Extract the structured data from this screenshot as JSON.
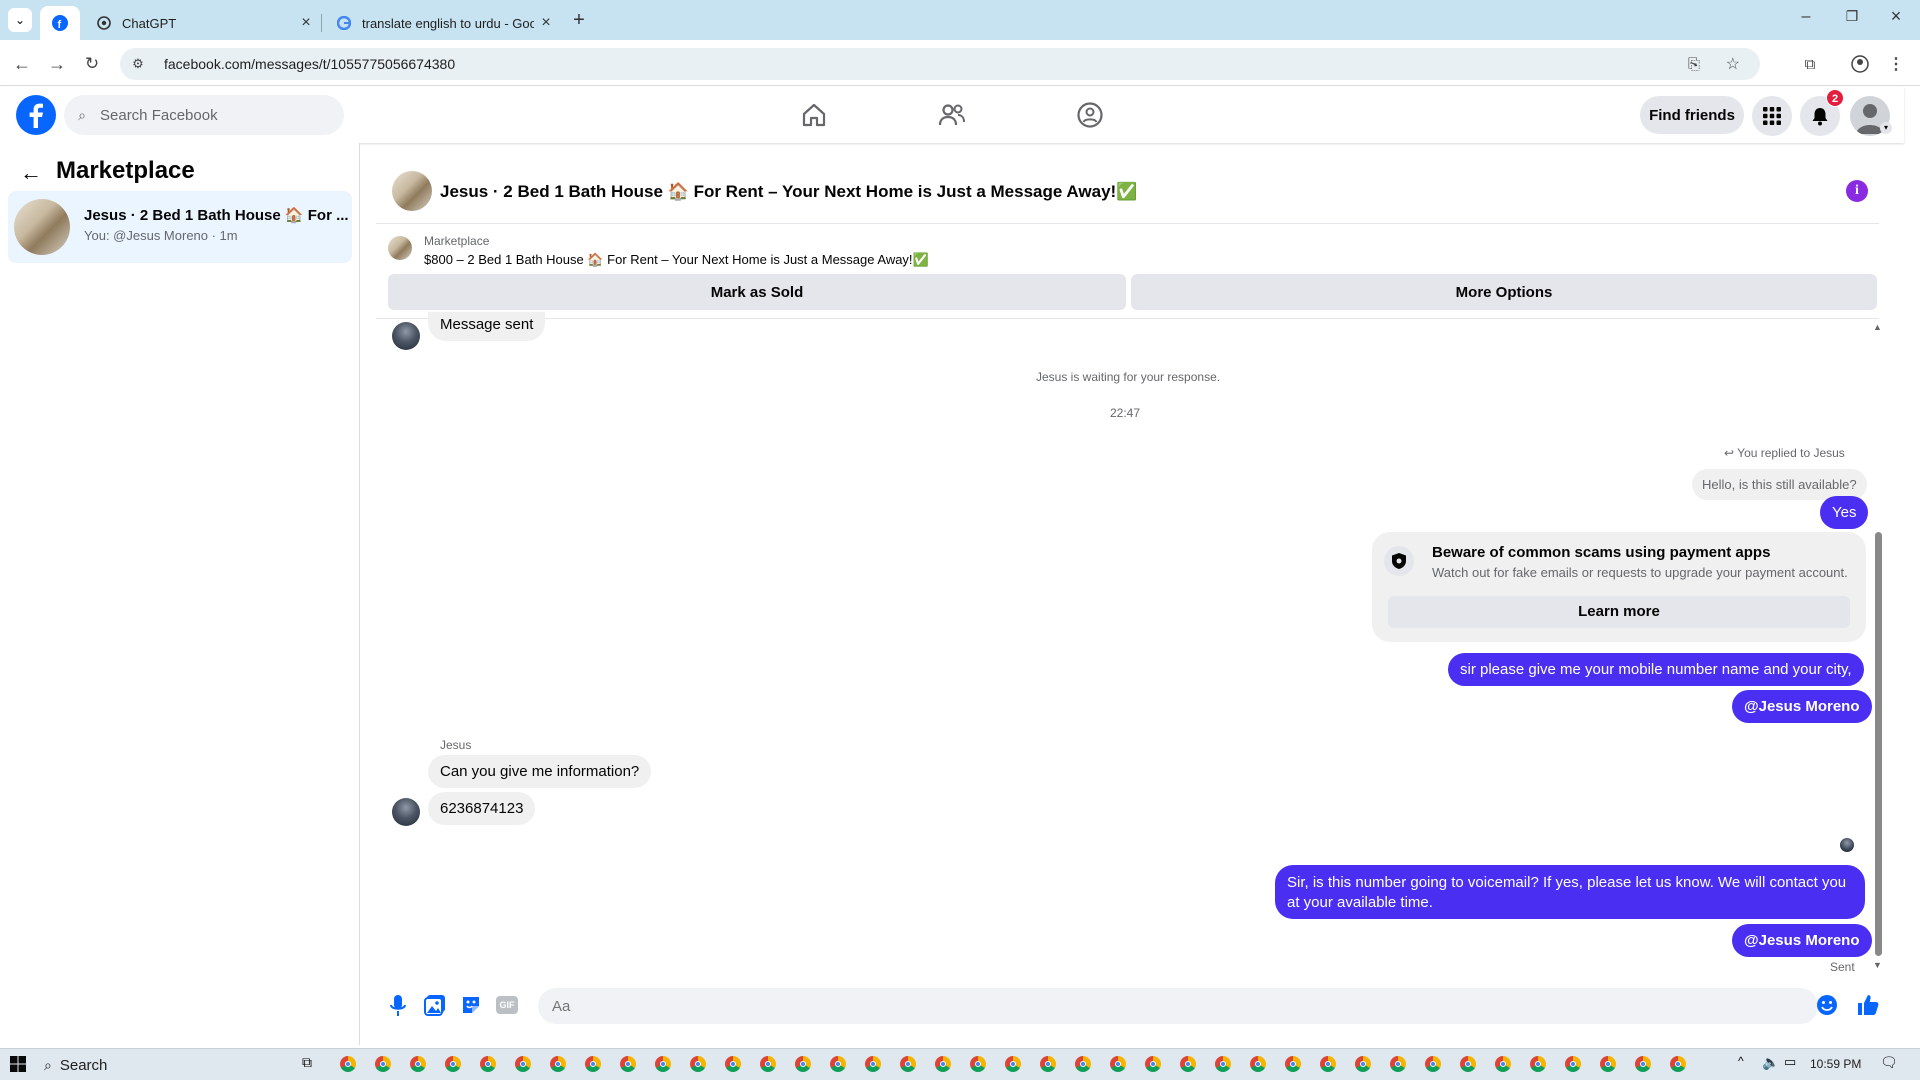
{
  "browser": {
    "tabs": [
      {
        "title": "",
        "icon": "facebook-icon"
      },
      {
        "title": "ChatGPT",
        "icon": "chatgpt-icon"
      },
      {
        "title": "translate english to urdu - Goo",
        "icon": "google-icon"
      }
    ],
    "url": "facebook.com/messages/t/1055775056674380"
  },
  "facebook": {
    "search_placeholder": "Search Facebook",
    "find_friends": "Find friends",
    "notification_count": "2"
  },
  "sidebar": {
    "title": "Marketplace",
    "conversation": {
      "title": "Jesus · 2 Bed 1 Bath House 🏠 For ...",
      "subtitle": "You: @Jesus Moreno · 1m"
    }
  },
  "chat": {
    "header_title": "Jesus · 2 Bed 1 Bath House 🏠 For Rent – Your Next Home is Just a Message Away!✅",
    "listing_source": "Marketplace",
    "listing_title": "$800 – 2 Bed 1 Bath House 🏠 For Rent – Your Next Home is Just a Message Away!✅",
    "mark_sold": "Mark as Sold",
    "more_options": "More Options",
    "first_message": "Message sent",
    "waiting_text": "Jesus is waiting for your response.",
    "timestamp": "22:47",
    "replied_to": "You replied to Jesus",
    "quoted": "Hello, is this still available?",
    "reply_yes": "Yes",
    "scam_title": "Beware of common scams using payment apps",
    "scam_body": "Watch out for fake emails or requests to upgrade your payment account.",
    "learn_more": "Learn more",
    "msg_request": "sir please give me your mobile number name and your city,",
    "mention": "@Jesus Moreno",
    "other_name": "Jesus",
    "other_msg1": "Can you give me information?",
    "other_msg2": "6236874123",
    "msg_voicemail_line1": "Sir, is this number going to voicemail? If yes, please let us know. We will contact you",
    "msg_voicemail_line2": "at your available time.",
    "mention2": "@Jesus Moreno",
    "sent_status": "Sent",
    "input_placeholder": "Aa"
  },
  "taskbar": {
    "search": "Search",
    "time": "10:59 PM"
  },
  "colors": {
    "facebook_blue": "#0866ff",
    "outgoing_bubble": "#4a2ef2",
    "tab_bar": "#c7e2f1"
  }
}
